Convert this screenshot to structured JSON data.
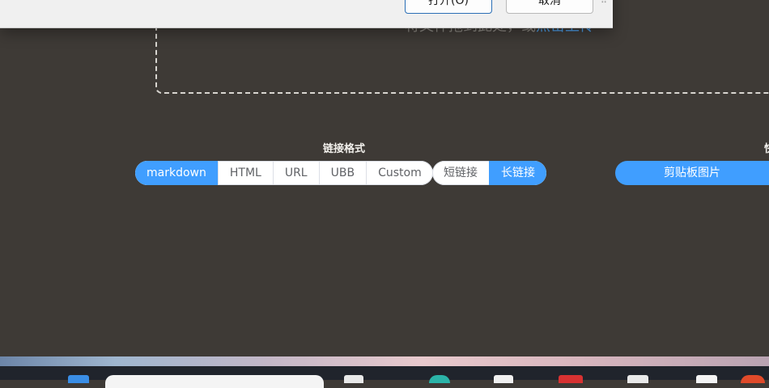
{
  "dialog": {
    "open_label": "打开(O)",
    "cancel_label": "取消"
  },
  "upload": {
    "hint_text": "将文件拖到此处，或",
    "hint_link": "点击上传"
  },
  "link_format": {
    "title": "链接格式",
    "formats": [
      {
        "label": "markdown",
        "active": true
      },
      {
        "label": "HTML",
        "active": false
      },
      {
        "label": "URL",
        "active": false
      },
      {
        "label": "UBB",
        "active": false
      },
      {
        "label": "Custom",
        "active": false
      }
    ],
    "lengths": [
      {
        "label": "短链接",
        "active": false
      },
      {
        "label": "长链接",
        "active": true
      }
    ]
  },
  "clipboard": {
    "title": "快",
    "button_label": "剪贴板图片"
  },
  "colors": {
    "accent": "#409eff",
    "background": "#3e3a36"
  }
}
